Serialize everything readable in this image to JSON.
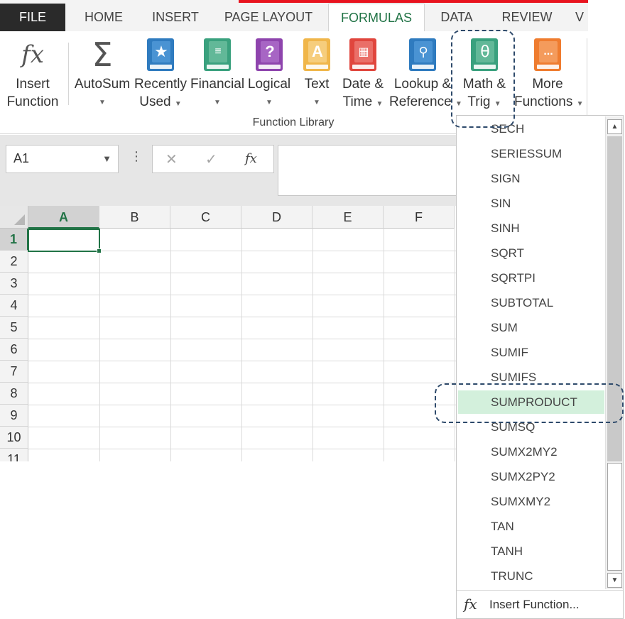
{
  "tabs": [
    "FILE",
    "HOME",
    "INSERT",
    "PAGE LAYOUT",
    "FORMULAS",
    "DATA",
    "REVIEW",
    "V"
  ],
  "active_tab": "FORMULAS",
  "ribbon": {
    "insert_function": [
      "Insert",
      "Function"
    ],
    "autosum": "AutoSum",
    "recently_used": [
      "Recently",
      "Used"
    ],
    "financial": "Financial",
    "logical": "Logical",
    "text": "Text",
    "date_time": [
      "Date &",
      "Time"
    ],
    "lookup": [
      "Lookup &",
      "Reference"
    ],
    "math_trig": [
      "Math &",
      "Trig"
    ],
    "more_functions": [
      "More",
      "Functions"
    ],
    "group_label": "Function Library",
    "icons": {
      "fx": "fx",
      "sigma": "Σ",
      "recently": "★",
      "logical": "?",
      "text": "A",
      "math": "θ",
      "more": "..."
    }
  },
  "formula_bar": {
    "name_box": "A1",
    "fx_label": "fx",
    "cancel_icon": "✕",
    "enter_icon": "✓",
    "dots": "⋮"
  },
  "grid": {
    "columns": [
      "A",
      "B",
      "C",
      "D",
      "E",
      "F"
    ],
    "rows": [
      "1",
      "2",
      "3",
      "4",
      "5",
      "6",
      "7",
      "8",
      "9",
      "10",
      "11"
    ],
    "selected_col": "A",
    "selected_row": "1"
  },
  "menu": {
    "items": [
      "SECH",
      "SERIESSUM",
      "SIGN",
      "SIN",
      "SINH",
      "SQRT",
      "SQRTPI",
      "SUBTOTAL",
      "SUM",
      "SUMIF",
      "SUMIFS",
      "SUMPRODUCT",
      "SUMSQ",
      "SUMX2MY2",
      "SUMX2PY2",
      "SUMXMY2",
      "TAN",
      "TANH",
      "TRUNC"
    ],
    "highlighted": "SUMPRODUCT",
    "footer_label": "Insert Function...",
    "footer_icon": "fx"
  },
  "colors": {
    "accent": "#217346",
    "highlight": "#d3f0dc",
    "callout": "#2e4a6b",
    "financial": "#3aa17e",
    "logical": "#8e44ad",
    "text": "#f0b64a",
    "date": "#e0463d",
    "lookup": "#2f7bbf",
    "math": "#3aa17e",
    "more": "#ef7c2f",
    "recently": "#2f7bbf"
  }
}
